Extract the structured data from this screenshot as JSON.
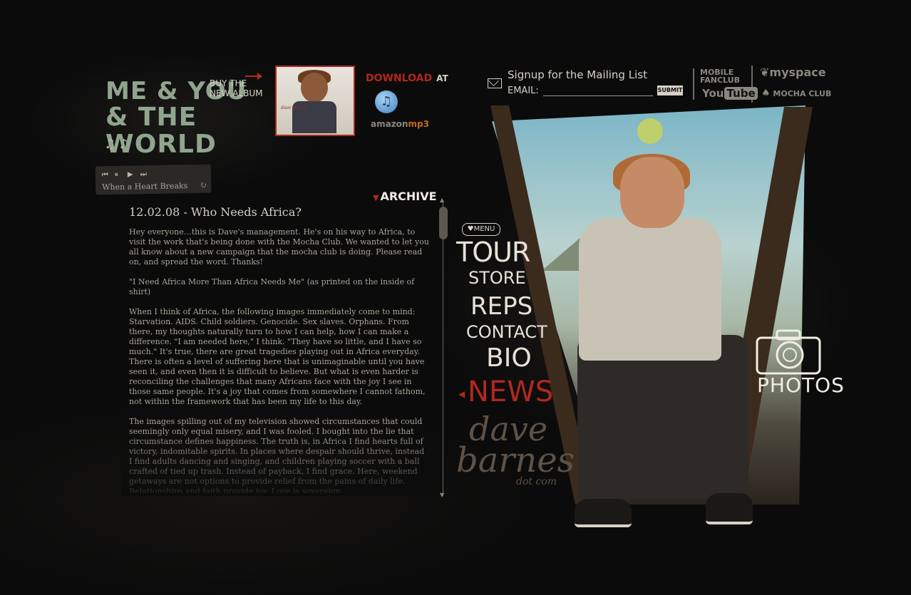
{
  "header": {
    "logo_line1": "ME & YOU",
    "logo_line2": "& THE WORLD",
    "buy_line1": "BUY THE",
    "buy_line2": "NEW ALBUM",
    "download": "DOWNLOAD",
    "download_at": "AT",
    "amazon": "amazon",
    "amazon_mp3": "mp3"
  },
  "player": {
    "track": "When a Heart Breaks",
    "controls": [
      "⏮",
      "⏸",
      "▶",
      "⏭"
    ]
  },
  "mailing": {
    "title": "Signup for the Mailing List",
    "email_label": "EMAIL:",
    "email_value": "",
    "submit": "SUBMIT"
  },
  "social": {
    "mobile_fanclub_1": "MOBILE",
    "mobile_fanclub_2": "FANCLUB",
    "youtube_you": "You",
    "youtube_tube": "Tube",
    "myspace": "myspace",
    "mochaclub": "MOCHA CLUB"
  },
  "archive": {
    "label": "ARCHIVE"
  },
  "article": {
    "title": "12.02.08 - Who Needs Africa?",
    "paragraphs": [
      "Hey everyone…this is Dave's management.  He's on his way to Africa, to visit the work that's being done with the Mocha Club.  We wanted to let you all know about a new campaign that the mocha club is doing.  Please read on, and spread the word.  Thanks!",
      "",
      "\"I Need Africa More Than Africa Needs Me\" (as printed on the inside of shirt)",
      "When I think of Africa, the following images immediately come to mind: Starvation. AIDS. Child soldiers. Genocide. Sex slaves. Orphans. From there, my thoughts naturally turn to how I can help, how I can make a difference. \"I am needed here,\" I think. \"They have so little, and I have so much.\" It's true, there are great tragedies playing out in Africa everyday. There is often a level of suffering here that is unimaginable until you have seen it, and even then it is difficult to believe. But what is even harder is reconciling the challenges that many Africans face with the joy I see in those same people. It's a joy that comes from somewhere I cannot fathom, not within the framework that has been my life to this day.",
      "The images spilling out of my television showed circumstances that could seemingly only equal misery, and I was fooled. I bought into the lie that circumstance defines happiness. The truth is, in Africa I find hearts full of victory, indomitable spirits. In places where despair should thrive, instead I find adults dancing and singing, and children playing soccer with a ball crafted of tied up trash. Instead of payback, I find grace. Here, weekend getaways are not options to provide relief from the pains of daily life. Relationships and faith provide joy. Love is sovereign."
    ]
  },
  "nav": {
    "menu": "♥MENU",
    "tour": "TOUR",
    "store": "STORE",
    "reps": "REPS",
    "contact": "CONTACT",
    "bio": "BIO",
    "news": "NEWS"
  },
  "brand": {
    "line1": "dave",
    "line2": "barnes",
    "line3": "dot com"
  },
  "photos": {
    "label": "PHOTOS"
  },
  "colors": {
    "accent_red": "#b0281f",
    "text": "#aaa398",
    "background": "#0b0b0b"
  }
}
